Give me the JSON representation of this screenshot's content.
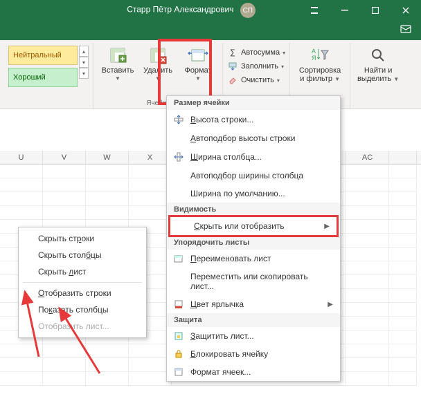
{
  "titlebar": {
    "user_name": "Старр Пётр Александрович",
    "user_initials": "СП"
  },
  "ribbon": {
    "styles": {
      "neutral": "Нейтральный",
      "good": "Хороший"
    },
    "insert": "Вставить",
    "delete": "Удалить",
    "format": "Формат",
    "cells_label": "Ячейки",
    "autosum": "Автосумма",
    "fill": "Заполнить",
    "clear": "Очистить",
    "sort_filter_l1": "Сортировка",
    "sort_filter_l2": "и фильтр",
    "find_sel_l1": "Найти и",
    "find_sel_l2": "выделить"
  },
  "columns": [
    "U",
    "V",
    "W",
    "X",
    "",
    "",
    "",
    "",
    "AC"
  ],
  "format_menu": {
    "sec_size": "Размер ячейки",
    "row_height": "Высота строки...",
    "autofit_row": "Автоподбор высоты строки",
    "col_width": "Ширина столбца...",
    "autofit_col": "Автоподбор ширины столбца",
    "default_width": "Ширина по умолчанию...",
    "sec_vis": "Видимость",
    "hide_unhide": "Скрыть или отобразить",
    "sec_org": "Упорядочить листы",
    "rename": "Переименовать лист",
    "move_copy": "Переместить или скопировать лист...",
    "tab_color": "Цвет ярлычка",
    "sec_protect": "Защита",
    "protect_sheet": "Защитить лист...",
    "lock_cell": "Блокировать ячейку",
    "cell_format": "Формат ячеек..."
  },
  "submenu": {
    "hide_rows": "Скрыть строки",
    "hide_cols": "Скрыть столбцы",
    "hide_sheet": "Скрыть лист",
    "unhide_rows": "Отобразить строки",
    "unhide_cols": "Показать столбцы",
    "unhide_sheet": "Отобразить лист..."
  }
}
